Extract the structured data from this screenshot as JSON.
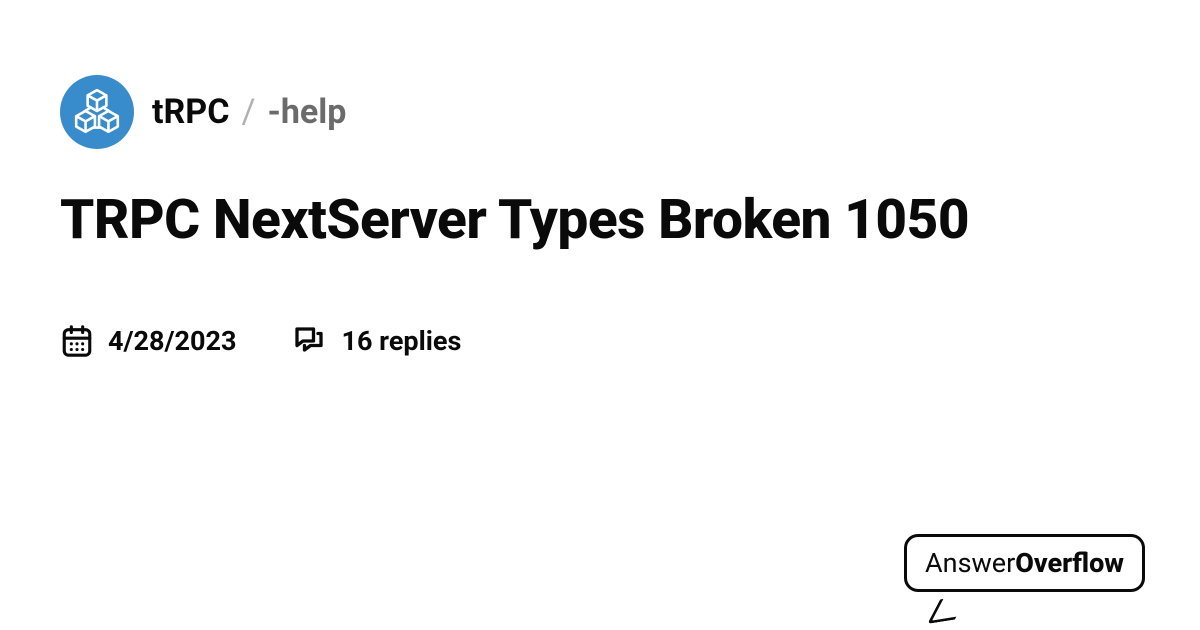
{
  "breadcrumb": {
    "org": "tRPC",
    "separator": "/",
    "channel": "-help"
  },
  "title": "TRPC NextServer Types Broken 1050",
  "meta": {
    "date": "4/28/2023",
    "replies": "16 replies"
  },
  "brand": {
    "part1": "Answer",
    "part2": "Overflow"
  },
  "colors": {
    "logo_bg": "#398ccb"
  }
}
